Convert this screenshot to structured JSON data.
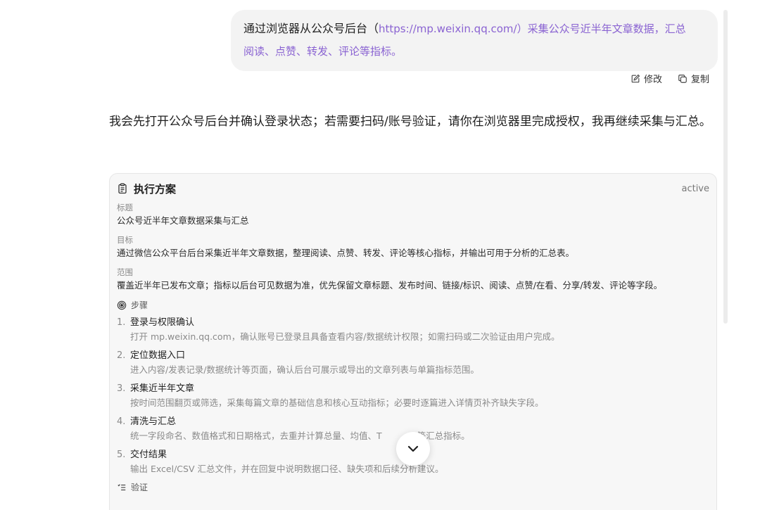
{
  "user_message": {
    "prefix": "通过浏览器从公众号后台（",
    "link": "https://mp.weixin.qq.com/",
    "suffix_1": "）采集公众号近半年文章数据，汇总",
    "line_2": "阅读、点赞、转发、评论等指标。"
  },
  "bubble_actions": {
    "edit_label": "修改",
    "copy_label": "复制"
  },
  "assistant_message": "我会先打开公众号后台并确认登录状态；若需要扫码/账号验证，请你在浏览器里完成授权，我再继续采集与汇总。",
  "plan": {
    "title": "执行方案",
    "status": "active",
    "title_label": "标题",
    "title_value": "公众号近半年文章数据采集与汇总",
    "goal_label": "目标",
    "goal_value": "通过微信公众平台后台采集近半年文章数据，整理阅读、点赞、转发、评论等核心指标，并输出可用于分析的汇总表。",
    "scope_label": "范围",
    "scope_value": "覆盖近半年已发布文章；指标以后台可见数据为准，优先保留文章标题、发布时间、链接/标识、阅读、点赞/在看、分享/转发、评论等字段。",
    "steps_label": "步骤",
    "steps": [
      {
        "num": "1.",
        "title": "登录与权限确认",
        "desc": "打开 mp.weixin.qq.com，确认账号已登录且具备查看内容/数据统计权限；如需扫码或二次验证由用户完成。"
      },
      {
        "num": "2.",
        "title": "定位数据入口",
        "desc": "进入内容/发表记录/数据统计等页面，确认后台可展示或导出的文章列表与单篇指标范围。"
      },
      {
        "num": "3.",
        "title": "采集近半年文章",
        "desc": "按时间范围翻页或筛选，采集每篇文章的基础信息和核心互动指标；必要时逐篇进入详情页补齐缺失字段。"
      },
      {
        "num": "4.",
        "title": "清洗与汇总",
        "desc": "统一字段命名、数值格式和日期格式，去重并计算总量、均值、T　　　　等汇总指标。"
      },
      {
        "num": "5.",
        "title": "交付结果",
        "desc": "输出 Excel/CSV 汇总文件，并在回复中说明数据口径、缺失项和后续分析建议。"
      }
    ],
    "verify_label": "验证"
  }
}
